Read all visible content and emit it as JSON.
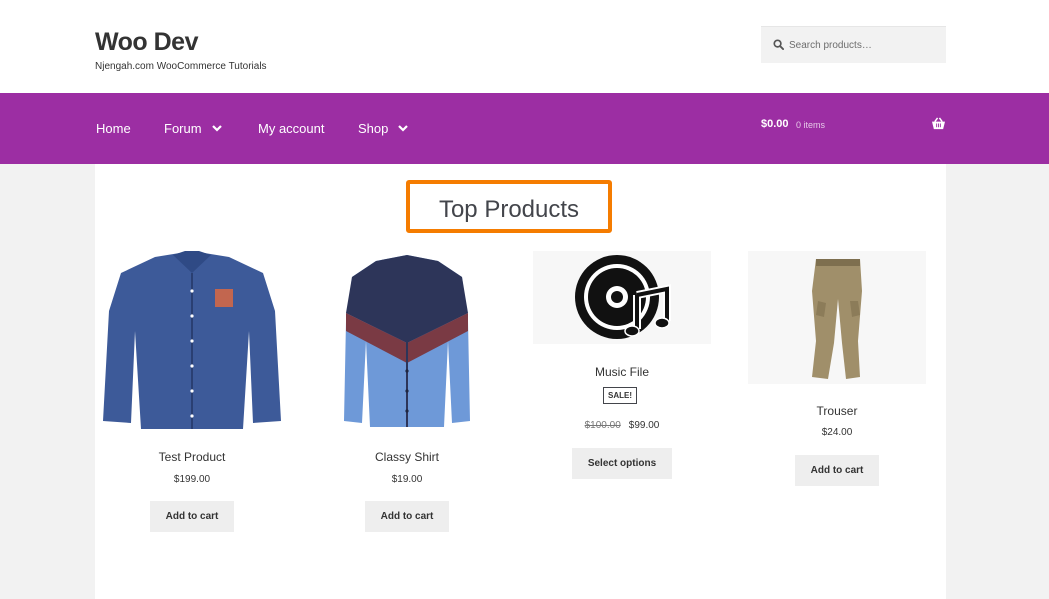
{
  "site": {
    "title": "Woo Dev",
    "tagline": "Njengah.com WooCommerce Tutorials"
  },
  "search": {
    "placeholder": "Search products…"
  },
  "nav": {
    "items": [
      {
        "label": "Home"
      },
      {
        "label": "Forum"
      },
      {
        "label": "My account"
      },
      {
        "label": "Shop"
      }
    ]
  },
  "cart": {
    "total": "$0.00",
    "count": "0 items"
  },
  "section": {
    "title": "Top Products"
  },
  "products": [
    {
      "name": "Test Product",
      "price": "$199.00",
      "button": "Add to cart"
    },
    {
      "name": "Classy Shirt",
      "price": "$19.00",
      "button": "Add to cart"
    },
    {
      "name": "Music File",
      "badge": "SALE!",
      "old_price": "$100.00",
      "price": "$99.00",
      "button": "Select options"
    },
    {
      "name": "Trouser",
      "price": "$24.00",
      "button": "Add to cart"
    }
  ],
  "colors": {
    "nav_bg": "#9c2ea3",
    "highlight_border": "#f57c00",
    "button_bg": "#eeeeee",
    "page_bg": "#f2f2f2"
  }
}
